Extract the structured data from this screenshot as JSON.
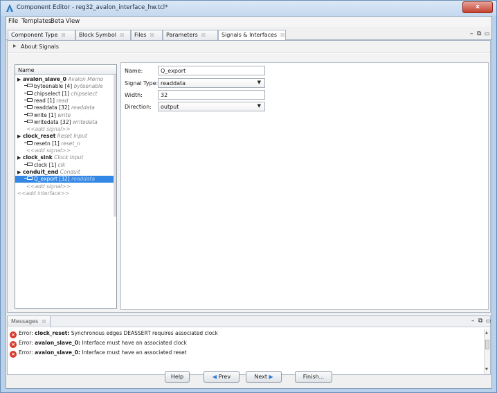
{
  "window": {
    "title": "Component Editor - reg32_avalon_interface_hw.tcl*",
    "close_label": "x"
  },
  "menu": [
    "File",
    "Templates",
    "Beta",
    "View"
  ],
  "editor_tabs": [
    {
      "label": "Component Type"
    },
    {
      "label": "Block Symbol"
    },
    {
      "label": "Files"
    },
    {
      "label": "Parameters"
    },
    {
      "label": "Signals & Interfaces",
      "active": true
    }
  ],
  "tab_close_glyph": "☒",
  "view_controls": {
    "minimize": "–",
    "maximize": "⧉"
  },
  "about": {
    "label": "About Signals"
  },
  "tree": {
    "header": "Name",
    "rows": [
      {
        "kind": "interface",
        "name": "avalon_slave_0",
        "type": "Avalon Memo"
      },
      {
        "kind": "signal",
        "name": "byteenable [4]",
        "type": "byteenable"
      },
      {
        "kind": "signal",
        "name": "chipselect [1]",
        "type": "chipselect"
      },
      {
        "kind": "signal",
        "name": "read [1]",
        "type": "read"
      },
      {
        "kind": "signal",
        "name": "readdata [32]",
        "type": "readdata"
      },
      {
        "kind": "signal",
        "name": "write [1]",
        "type": "write"
      },
      {
        "kind": "signal",
        "name": "writedata [32]",
        "type": "writedata"
      },
      {
        "kind": "add",
        "name": "<<add signal>>"
      },
      {
        "kind": "interface",
        "name": "clock_reset",
        "type": "Reset Input"
      },
      {
        "kind": "signal",
        "name": "resetn [1]",
        "type": "reset_n"
      },
      {
        "kind": "add",
        "name": "<<add signal>>"
      },
      {
        "kind": "interface",
        "name": "clock_sink",
        "type": "Clock Input"
      },
      {
        "kind": "signal",
        "name": "clock [1]",
        "type": "clk"
      },
      {
        "kind": "interface",
        "name": "conduit_end",
        "type": "Conduit"
      },
      {
        "kind": "signal",
        "name": "Q_export [32]",
        "type": "readdata",
        "selected": true
      },
      {
        "kind": "add",
        "name": "<<add signal>>"
      },
      {
        "kind": "add-interface",
        "name": "<<add interface>>"
      }
    ]
  },
  "properties": {
    "name_label": "Name:",
    "name_value": "Q_export",
    "signal_type_label": "Signal Type:",
    "signal_type_value": "readdata",
    "width_label": "Width:",
    "width_value": "32",
    "direction_label": "Direction:",
    "direction_value": "output"
  },
  "messages": {
    "tab_label": "Messages",
    "items": [
      {
        "prefix": "Error:",
        "bold": "clock_reset:",
        "text": "Synchronous edges DEASSERT requires associated clock"
      },
      {
        "prefix": "Error:",
        "bold": "avalon_slave_0:",
        "text": "Interface must have an associated clock"
      },
      {
        "prefix": "Error:",
        "bold": "avalon_slave_0:",
        "text": "Interface must have an associated reset"
      }
    ]
  },
  "buttons": {
    "help": "Help",
    "prev": "Prev",
    "next": "Next",
    "finish": "Finish..."
  },
  "colors": {
    "selection": "#3388e6",
    "error": "#d8392a",
    "nav_arrow": "#2f7fd6"
  }
}
